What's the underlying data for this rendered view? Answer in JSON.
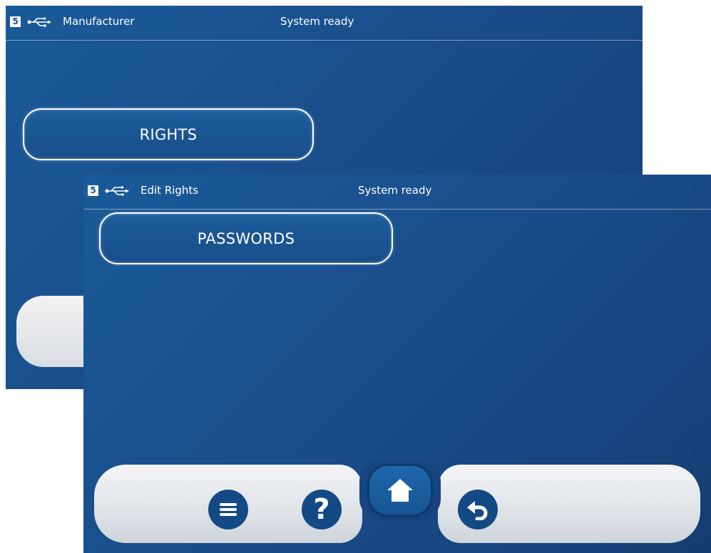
{
  "back_screen": {
    "level": "5",
    "usb_icon": "usb-icon",
    "title": "Manufacturer",
    "status": "System ready",
    "rights_button": "RIGHTS"
  },
  "front_screen": {
    "level": "5",
    "usb_icon": "usb-icon",
    "title": "Edit Rights",
    "status": "System ready",
    "passwords_button": "PASSWORDS"
  },
  "bottom_nav": {
    "items": [
      {
        "icon": "menu-icon"
      },
      {
        "icon": "help-icon",
        "glyph": "?"
      },
      {
        "icon": "home-icon"
      },
      {
        "icon": "undo-icon"
      }
    ]
  },
  "colors": {
    "screen_background": "#1a4f8c",
    "button_dark": "#134a85",
    "bar_light": "#e6e9ed",
    "text": "#ffffff"
  }
}
